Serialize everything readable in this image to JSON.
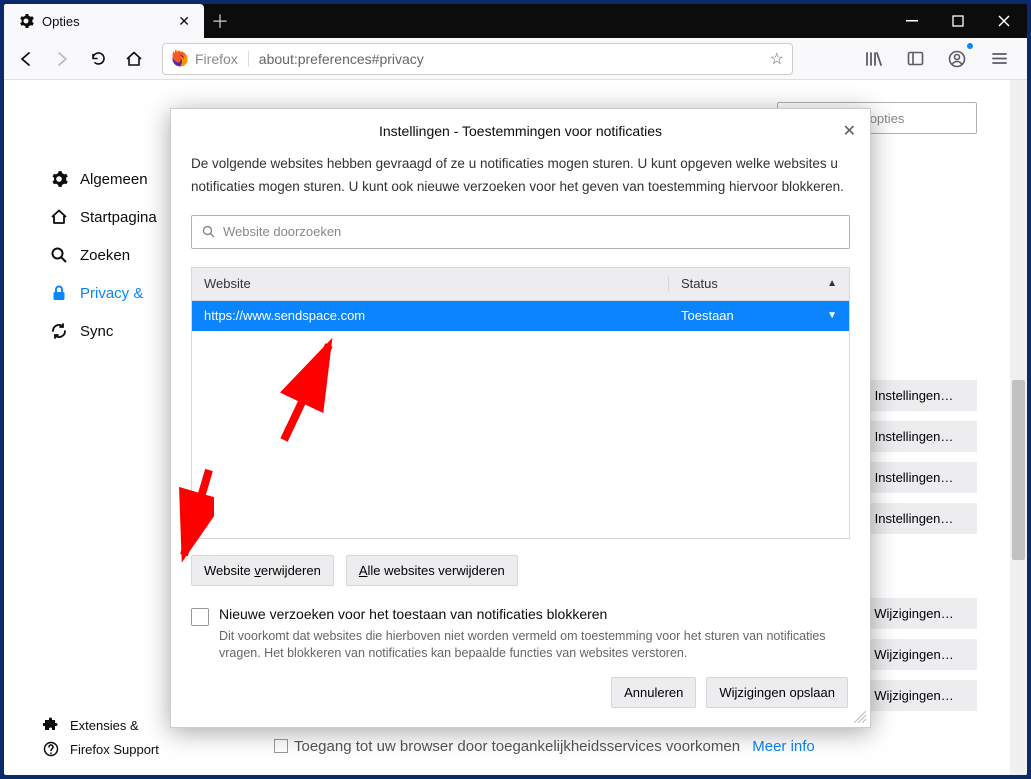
{
  "tab": {
    "title": "Opties"
  },
  "urlbar": {
    "identity": "Firefox",
    "url": "about:preferences#privacy"
  },
  "search_options": {
    "placeholder": "Zoeken in opties"
  },
  "sidebar": {
    "items": [
      {
        "label": "Algemeen"
      },
      {
        "label": "Startpagina"
      },
      {
        "label": "Zoeken"
      },
      {
        "label": "Privacy & "
      },
      {
        "label": "Sync"
      }
    ]
  },
  "bottom_links": {
    "ext": "Extensies & ",
    "support": "Firefox Support"
  },
  "bg_btns": {
    "set": "Instellingen…",
    "chg": "Wijzigingen…"
  },
  "fragment": {
    "text": "Toegang tot uw browser door toegankelijkheidsservices voorkomen",
    "link": "Meer info"
  },
  "modal": {
    "title": "Instellingen - Toestemmingen voor notificaties",
    "desc": "De volgende websites hebben gevraagd of ze u notificaties mogen sturen. U kunt opgeven welke websites u notificaties mogen sturen. U kunt ook nieuwe verzoeken voor het geven van toestemming hiervoor blokkeren.",
    "search_placeholder": "Website doorzoeken",
    "col_website": "Website",
    "col_status": "Status",
    "rows": [
      {
        "url": "https://www.sendspace.com",
        "status": "Toestaan"
      }
    ],
    "remove_one": "Website verwijderen",
    "remove_all": "Alle websites verwijderen",
    "block_label": "Nieuwe verzoeken voor het toestaan van notificaties blokkeren",
    "block_help": "Dit voorkomt dat websites die hierboven niet worden vermeld om toestemming voor het sturen van notificaties vragen. Het blokkeren van notificaties kan bepaalde functies van websites verstoren.",
    "cancel": "Annuleren",
    "save": "Wijzigingen opslaan"
  }
}
